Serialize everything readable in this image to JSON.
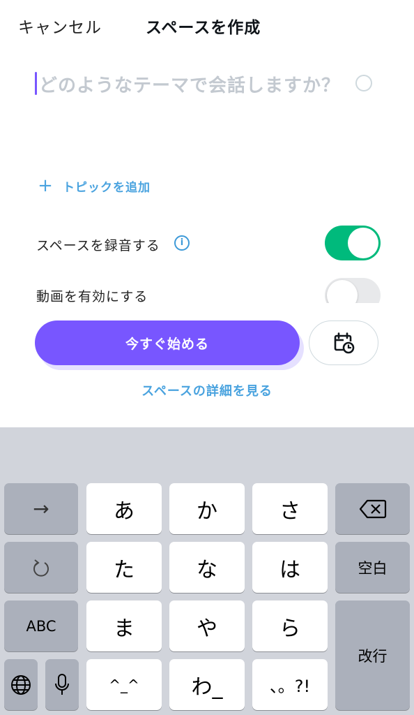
{
  "header": {
    "cancel_label": "キャンセル",
    "title": "スペースを作成"
  },
  "topic": {
    "placeholder": "どのようなテーマで会話しますか？"
  },
  "add_topic": {
    "plus": "+",
    "label": "トピックを追加"
  },
  "options": {
    "record_label": "スペースを録音する",
    "record_enabled": true,
    "info_glyph": "i",
    "video_label": "動画を有効にする",
    "video_enabled": false
  },
  "actions": {
    "start_now_label": "今すぐ始める",
    "schedule_icon": "calendar-clock-icon",
    "details_link": "スペースの詳細を見る"
  },
  "keyboard": {
    "arrow_key": "→",
    "undo_key": "↺",
    "abc_key": "ABC",
    "globe_icon": "globe-icon",
    "mic_icon": "microphone-icon",
    "row1": [
      "あ",
      "か",
      "さ"
    ],
    "row2": [
      "た",
      "な",
      "は"
    ],
    "row3": [
      "ま",
      "や",
      "ら"
    ],
    "row4": [
      "^_^",
      "わ_",
      "、。?!"
    ],
    "delete_icon": "delete-backspace-icon",
    "space_key": "空白",
    "return_key": "改行"
  },
  "colors": {
    "accent": "#7856ff",
    "toggle_on": "#00ba7c",
    "link": "#4aa3df",
    "keyboard_bg": "#d1d4db"
  }
}
